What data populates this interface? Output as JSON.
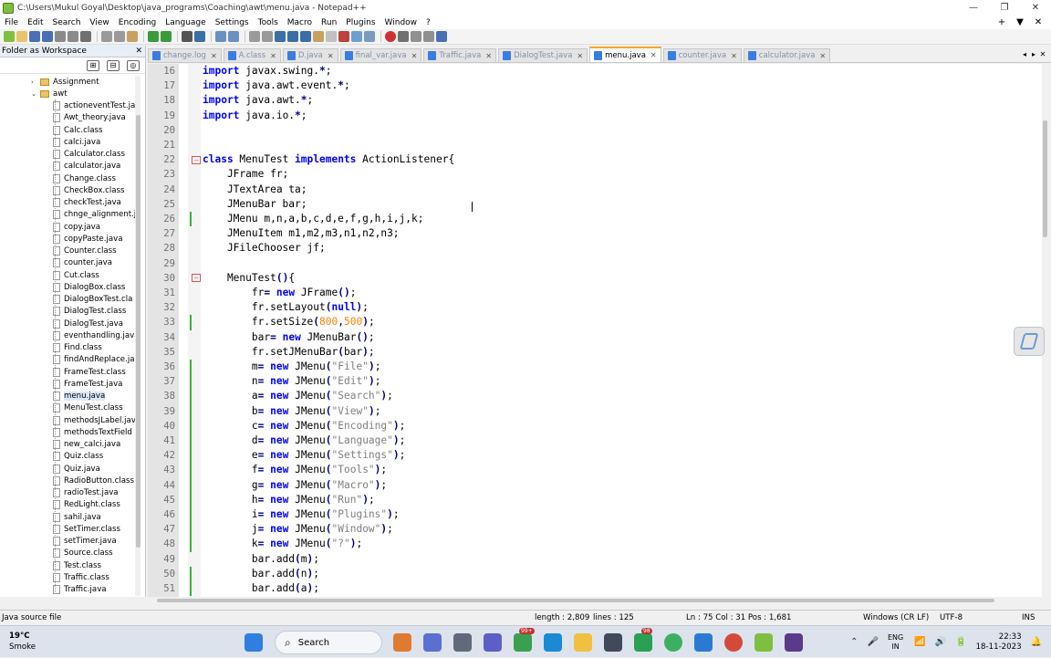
{
  "window": {
    "title": "C:\\Users\\Mukul Goyal\\Desktop\\java_programs\\Coaching\\awt\\menu.java - Notepad++",
    "minimize_glyph": "—",
    "restore_glyph": "❐",
    "close_glyph": "✕"
  },
  "menubar": {
    "items": [
      "File",
      "Edit",
      "Search",
      "View",
      "Encoding",
      "Language",
      "Settings",
      "Tools",
      "Macro",
      "Run",
      "Plugins",
      "Window",
      "?"
    ],
    "right_glyphs": [
      "+",
      "▼",
      "✕"
    ]
  },
  "panel": {
    "title": "Folder as Workspace",
    "close_glyph": "✕",
    "folders": [
      {
        "label": "Assignment",
        "arrow": "›"
      },
      {
        "label": "awt",
        "arrow": "⌄"
      }
    ],
    "files": [
      "actioneventTest.ja",
      "Awt_theory.java",
      "Calc.class",
      "calci.java",
      "Calculator.class",
      "calculator.java",
      "Change.class",
      "CheckBox.class",
      "checkTest.java",
      "chnge_alignment.j",
      "copy.java",
      "copyPaste.java",
      "Counter.class",
      "counter.java",
      "Cut.class",
      "DialogBox.class",
      "DialogBoxTest.cla",
      "DialogTest.class",
      "DialogTest.java",
      "eventhandling.java",
      "Find.class",
      "findAndReplace.ja",
      "FrameTest.class",
      "FrameTest.java",
      "menu.java",
      "MenuTest.class",
      "methodsJLabel.jav",
      "methodsTextField",
      "new_calci.java",
      "Quiz.class",
      "Quiz.java",
      "RadioButton.class",
      "radioTest.java",
      "RedLight.class",
      "sahil.java",
      "SetTimer.class",
      "setTimer.java",
      "Source.class",
      "Test.class",
      "Traffic.class",
      "Traffic.java"
    ],
    "selected_file": "menu.java"
  },
  "tabs": {
    "items": [
      "change.log",
      "A.class",
      "D.java",
      "final_var.java",
      "Traffic.java",
      "DialogTest.java",
      "menu.java",
      "counter.java",
      "calculator.java"
    ],
    "active": "menu.java",
    "close_glyph": "✕",
    "nav_glyphs": [
      "◂",
      "▸",
      "✕"
    ]
  },
  "editor": {
    "lines": [
      {
        "n": "16",
        "code": [
          [
            "kw",
            "import"
          ],
          [
            "p",
            " javax.swing."
          ],
          [
            "op",
            "*"
          ],
          [
            "p",
            ";"
          ]
        ]
      },
      {
        "n": "17",
        "code": [
          [
            "kw",
            "import"
          ],
          [
            "p",
            " java.awt.event."
          ],
          [
            "op",
            "*"
          ],
          [
            "p",
            ";"
          ]
        ]
      },
      {
        "n": "18",
        "code": [
          [
            "kw",
            "import"
          ],
          [
            "p",
            " java.awt."
          ],
          [
            "op",
            "*"
          ],
          [
            "p",
            ";"
          ]
        ]
      },
      {
        "n": "19",
        "code": [
          [
            "kw",
            "import"
          ],
          [
            "p",
            " java.io."
          ],
          [
            "op",
            "*"
          ],
          [
            "p",
            ";"
          ]
        ]
      },
      {
        "n": "20",
        "code": []
      },
      {
        "n": "21",
        "code": []
      },
      {
        "n": "22",
        "code": [
          [
            "kw",
            "class"
          ],
          [
            "p",
            " MenuTest "
          ],
          [
            "kw",
            "implements"
          ],
          [
            "p",
            " ActionListener{"
          ]
        ]
      },
      {
        "n": "23",
        "code": [
          [
            "p",
            "    JFrame fr;"
          ]
        ]
      },
      {
        "n": "24",
        "code": [
          [
            "p",
            "    JTextArea ta;"
          ]
        ]
      },
      {
        "n": "25",
        "code": [
          [
            "p",
            "    JMenuBar bar;"
          ]
        ]
      },
      {
        "n": "26",
        "code": [
          [
            "p",
            "    JMenu m,n,a,b,c,d,e,f,g,h,i,j,k;"
          ]
        ]
      },
      {
        "n": "27",
        "code": [
          [
            "p",
            "    JMenuItem m1,m2,m3,n1,n2,n3;"
          ]
        ]
      },
      {
        "n": "28",
        "code": [
          [
            "p",
            "    JFileChooser jf;"
          ]
        ]
      },
      {
        "n": "29",
        "code": []
      },
      {
        "n": "30",
        "code": [
          [
            "p",
            "    MenuTest"
          ],
          [
            "op",
            "()"
          ],
          [
            "p",
            "{"
          ]
        ]
      },
      {
        "n": "31",
        "code": [
          [
            "p",
            "        fr"
          ],
          [
            "op",
            "="
          ],
          [
            "p",
            " "
          ],
          [
            "kw",
            "new"
          ],
          [
            "p",
            " JFrame"
          ],
          [
            "op",
            "()"
          ],
          [
            "p",
            ";"
          ]
        ]
      },
      {
        "n": "32",
        "code": [
          [
            "p",
            "        fr.setLayout"
          ],
          [
            "op",
            "("
          ],
          [
            "kw",
            "null"
          ],
          [
            "op",
            ")"
          ],
          [
            "p",
            ";"
          ]
        ]
      },
      {
        "n": "33",
        "code": [
          [
            "p",
            "        fr.setSize"
          ],
          [
            "op",
            "("
          ],
          [
            "nm",
            "800"
          ],
          [
            "p",
            ","
          ],
          [
            "nm",
            "500"
          ],
          [
            "op",
            ")"
          ],
          [
            "p",
            ";"
          ]
        ]
      },
      {
        "n": "34",
        "code": [
          [
            "p",
            "        bar"
          ],
          [
            "op",
            "="
          ],
          [
            "p",
            " "
          ],
          [
            "kw",
            "new"
          ],
          [
            "p",
            " JMenuBar"
          ],
          [
            "op",
            "()"
          ],
          [
            "p",
            ";"
          ]
        ]
      },
      {
        "n": "35",
        "code": [
          [
            "p",
            "        fr.setJMenuBar"
          ],
          [
            "op",
            "("
          ],
          [
            "p",
            "bar"
          ],
          [
            "op",
            ")"
          ],
          [
            "p",
            ";"
          ]
        ]
      },
      {
        "n": "36",
        "code": [
          [
            "p",
            "        m"
          ],
          [
            "op",
            "="
          ],
          [
            "p",
            " "
          ],
          [
            "kw",
            "new"
          ],
          [
            "p",
            " JMenu"
          ],
          [
            "op",
            "("
          ],
          [
            "str",
            "\"File\""
          ],
          [
            "op",
            ")"
          ],
          [
            "p",
            ";"
          ]
        ]
      },
      {
        "n": "37",
        "code": [
          [
            "p",
            "        n"
          ],
          [
            "op",
            "="
          ],
          [
            "p",
            " "
          ],
          [
            "kw",
            "new"
          ],
          [
            "p",
            " JMenu"
          ],
          [
            "op",
            "("
          ],
          [
            "str",
            "\"Edit\""
          ],
          [
            "op",
            ")"
          ],
          [
            "p",
            ";"
          ]
        ]
      },
      {
        "n": "38",
        "code": [
          [
            "p",
            "        a"
          ],
          [
            "op",
            "="
          ],
          [
            "p",
            " "
          ],
          [
            "kw",
            "new"
          ],
          [
            "p",
            " JMenu"
          ],
          [
            "op",
            "("
          ],
          [
            "str",
            "\"Search\""
          ],
          [
            "op",
            ")"
          ],
          [
            "p",
            ";"
          ]
        ]
      },
      {
        "n": "39",
        "code": [
          [
            "p",
            "        b"
          ],
          [
            "op",
            "="
          ],
          [
            "p",
            " "
          ],
          [
            "kw",
            "new"
          ],
          [
            "p",
            " JMenu"
          ],
          [
            "op",
            "("
          ],
          [
            "str",
            "\"View\""
          ],
          [
            "op",
            ")"
          ],
          [
            "p",
            ";"
          ]
        ]
      },
      {
        "n": "40",
        "code": [
          [
            "p",
            "        c"
          ],
          [
            "op",
            "="
          ],
          [
            "p",
            " "
          ],
          [
            "kw",
            "new"
          ],
          [
            "p",
            " JMenu"
          ],
          [
            "op",
            "("
          ],
          [
            "str",
            "\"Encoding\""
          ],
          [
            "op",
            ")"
          ],
          [
            "p",
            ";"
          ]
        ]
      },
      {
        "n": "41",
        "code": [
          [
            "p",
            "        d"
          ],
          [
            "op",
            "="
          ],
          [
            "p",
            " "
          ],
          [
            "kw",
            "new"
          ],
          [
            "p",
            " JMenu"
          ],
          [
            "op",
            "("
          ],
          [
            "str",
            "\"Language\""
          ],
          [
            "op",
            ")"
          ],
          [
            "p",
            ";"
          ]
        ]
      },
      {
        "n": "42",
        "code": [
          [
            "p",
            "        e"
          ],
          [
            "op",
            "="
          ],
          [
            "p",
            " "
          ],
          [
            "kw",
            "new"
          ],
          [
            "p",
            " JMenu"
          ],
          [
            "op",
            "("
          ],
          [
            "str",
            "\"Settings\""
          ],
          [
            "op",
            ")"
          ],
          [
            "p",
            ";"
          ]
        ]
      },
      {
        "n": "43",
        "code": [
          [
            "p",
            "        f"
          ],
          [
            "op",
            "="
          ],
          [
            "p",
            " "
          ],
          [
            "kw",
            "new"
          ],
          [
            "p",
            " JMenu"
          ],
          [
            "op",
            "("
          ],
          [
            "str",
            "\"Tools\""
          ],
          [
            "op",
            ")"
          ],
          [
            "p",
            ";"
          ]
        ]
      },
      {
        "n": "44",
        "code": [
          [
            "p",
            "        g"
          ],
          [
            "op",
            "="
          ],
          [
            "p",
            " "
          ],
          [
            "kw",
            "new"
          ],
          [
            "p",
            " JMenu"
          ],
          [
            "op",
            "("
          ],
          [
            "str",
            "\"Macro\""
          ],
          [
            "op",
            ")"
          ],
          [
            "p",
            ";"
          ]
        ]
      },
      {
        "n": "45",
        "code": [
          [
            "p",
            "        h"
          ],
          [
            "op",
            "="
          ],
          [
            "p",
            " "
          ],
          [
            "kw",
            "new"
          ],
          [
            "p",
            " JMenu"
          ],
          [
            "op",
            "("
          ],
          [
            "str",
            "\"Run\""
          ],
          [
            "op",
            ")"
          ],
          [
            "p",
            ";"
          ]
        ]
      },
      {
        "n": "46",
        "code": [
          [
            "p",
            "        i"
          ],
          [
            "op",
            "="
          ],
          [
            "p",
            " "
          ],
          [
            "kw",
            "new"
          ],
          [
            "p",
            " JMenu"
          ],
          [
            "op",
            "("
          ],
          [
            "str",
            "\"Plugins\""
          ],
          [
            "op",
            ")"
          ],
          [
            "p",
            ";"
          ]
        ]
      },
      {
        "n": "47",
        "code": [
          [
            "p",
            "        j"
          ],
          [
            "op",
            "="
          ],
          [
            "p",
            " "
          ],
          [
            "kw",
            "new"
          ],
          [
            "p",
            " JMenu"
          ],
          [
            "op",
            "("
          ],
          [
            "str",
            "\"Window\""
          ],
          [
            "op",
            ")"
          ],
          [
            "p",
            ";"
          ]
        ]
      },
      {
        "n": "48",
        "code": [
          [
            "p",
            "        k"
          ],
          [
            "op",
            "="
          ],
          [
            "p",
            " "
          ],
          [
            "kw",
            "new"
          ],
          [
            "p",
            " JMenu"
          ],
          [
            "op",
            "("
          ],
          [
            "str",
            "\"?\""
          ],
          [
            "op",
            ")"
          ],
          [
            "p",
            ";"
          ]
        ]
      },
      {
        "n": "49",
        "code": [
          [
            "p",
            "        bar.add"
          ],
          [
            "op",
            "("
          ],
          [
            "p",
            "m"
          ],
          [
            "op",
            ")"
          ],
          [
            "p",
            ";"
          ]
        ]
      },
      {
        "n": "50",
        "code": [
          [
            "p",
            "        bar.add"
          ],
          [
            "op",
            "("
          ],
          [
            "p",
            "n"
          ],
          [
            "op",
            ")"
          ],
          [
            "p",
            ";"
          ]
        ]
      },
      {
        "n": "51",
        "code": [
          [
            "p",
            "        bar.add"
          ],
          [
            "op",
            "("
          ],
          [
            "p",
            "a"
          ],
          [
            "op",
            ")"
          ],
          [
            "p",
            ";"
          ]
        ]
      }
    ],
    "changed_lines": [
      "26",
      "33",
      "36",
      "37",
      "38",
      "39",
      "40",
      "41",
      "42",
      "43",
      "44",
      "45",
      "46",
      "47",
      "48",
      "50",
      "51"
    ],
    "fold_lines": [
      "22",
      "30"
    ],
    "fold_glyph": "−"
  },
  "statusbar": {
    "filetype": "Java source file",
    "length": "length : 2,809",
    "lines": "lines : 125",
    "position": "Ln : 75    Col : 31    Pos : 1,681",
    "eol": "Windows (CR LF)",
    "encoding": "UTF-8",
    "mode": "INS"
  },
  "taskbar": {
    "temperature": "19°C",
    "weather": "Smoke",
    "search_label": "Search",
    "search_glyph": "⌕",
    "badge_a": "99+",
    "badge_b": "98",
    "lang_top": "ENG",
    "lang_bottom": "IN",
    "time": "22:33",
    "date": "18-11-2023",
    "tray_glyphs": [
      "⌃",
      "🎤",
      "📶",
      "🔊",
      "🔋",
      "🔔"
    ]
  },
  "colors": {
    "keyword": "#0000ff",
    "operator": "#000080",
    "string": "#808080",
    "number": "#ff8000",
    "tab_accent": "#f5a623",
    "change_marker": "#3cb043"
  }
}
